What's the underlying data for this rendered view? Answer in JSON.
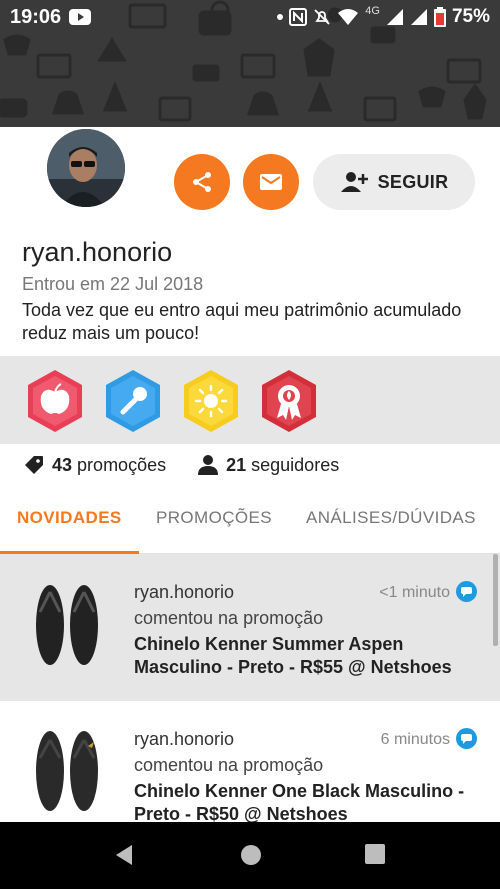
{
  "status_bar": {
    "time": "19:06",
    "network": "4G",
    "battery": "75%"
  },
  "profile": {
    "username": "ryan.honorio",
    "joined": "Entrou em 22 Jul 2018",
    "bio": "Toda vez que eu entro aqui meu patrimônio acumulado reduz mais um pouco!",
    "follow_label": "SEGUIR"
  },
  "colors": {
    "accent": "#f47920",
    "badge_red": "#e83f57",
    "badge_blue": "#2f9be3",
    "badge_yellow": "#f6cc1e",
    "badge_dark_red": "#d32f3a",
    "comment_blue": "#1e9be0"
  },
  "badges": [
    {
      "icon": "apple-icon",
      "color": "#e83f57"
    },
    {
      "icon": "microphone-icon",
      "color": "#2f9be3"
    },
    {
      "icon": "sun-icon",
      "color": "#f6cc1e"
    },
    {
      "icon": "award-ribbon-icon",
      "color": "#d32f3a"
    }
  ],
  "stats": {
    "promotions_count": "43",
    "promotions_label": "promoções",
    "followers_count": "21",
    "followers_label": "seguidores"
  },
  "tabs": [
    {
      "label": "NOVIDADES",
      "active": true
    },
    {
      "label": "PROMOÇÕES",
      "active": false
    },
    {
      "label": "ANÁLISES/DÚVIDAS",
      "active": false
    }
  ],
  "feed": [
    {
      "user": "ryan.honorio",
      "time": "<1 minuto",
      "action": "comentou na promoção",
      "title": "Chinelo Kenner Summer Aspen Masculino - Preto - R$55 @ Netshoes"
    },
    {
      "user": "ryan.honorio",
      "time": "6 minutos",
      "action": "comentou na promoção",
      "title": "Chinelo Kenner One Black Masculino - Preto - R$50 @ Netshoes"
    }
  ]
}
